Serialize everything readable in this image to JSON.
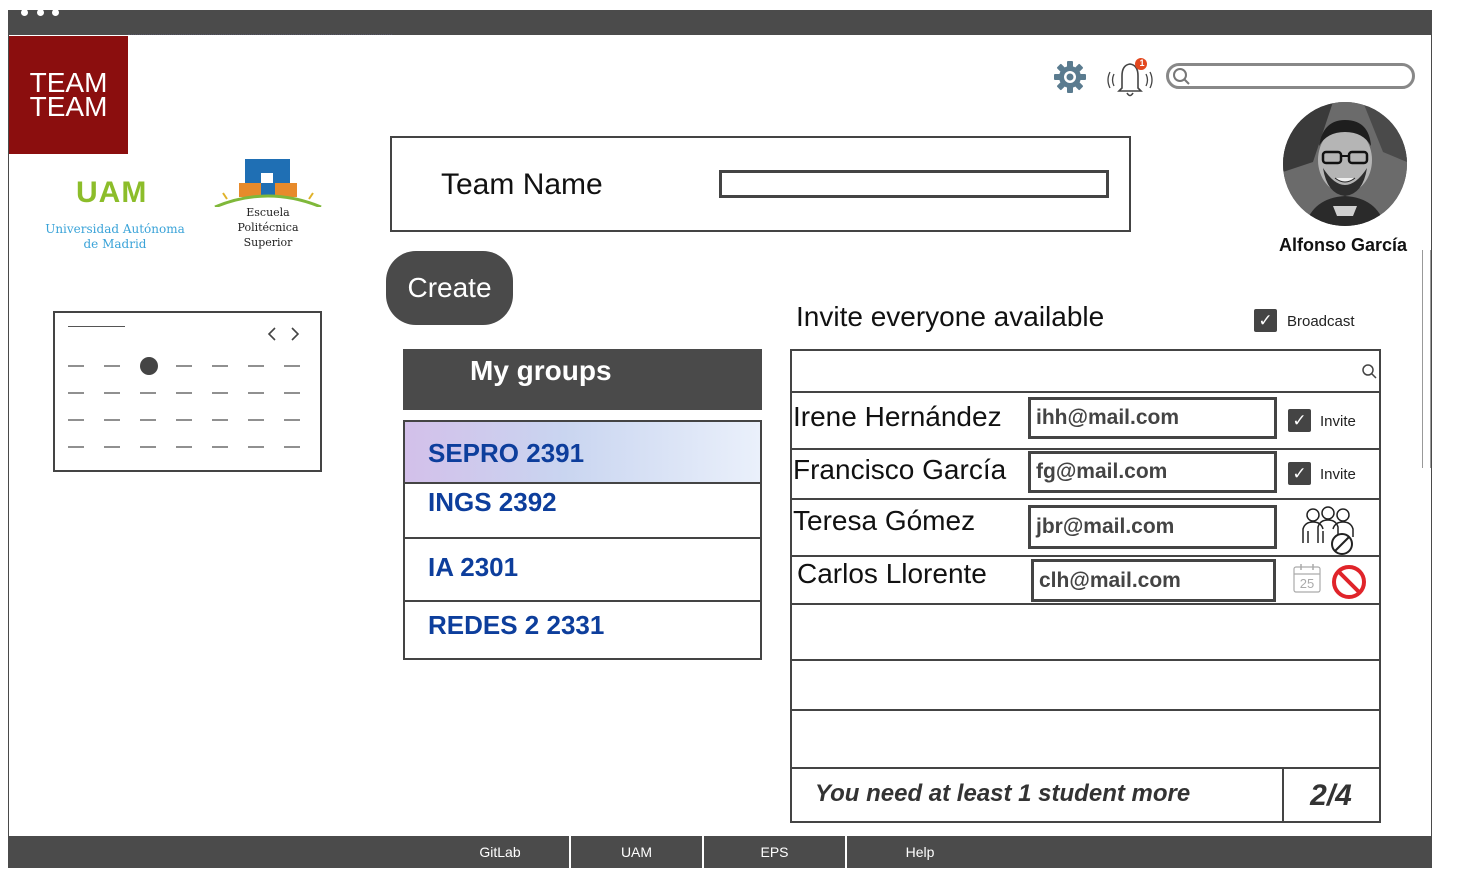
{
  "logo": {
    "line1": "TEAM",
    "line2": "TEAM"
  },
  "uam": {
    "mark": "UAM",
    "line1": "Universidad Autónoma",
    "line2": "de Madrid"
  },
  "eps": {
    "line1": "Escuela",
    "line2": "Politécnica",
    "line3": "Superior"
  },
  "header": {
    "notification_count": "1",
    "search_placeholder": "",
    "user_name": "Alfonso García"
  },
  "team_form": {
    "label": "Team Name",
    "value": "",
    "create_label": "Create"
  },
  "groups": {
    "title": "My groups",
    "items": [
      {
        "label": "SEPRO 2391",
        "selected": true
      },
      {
        "label": "INGS 2392",
        "selected": false
      },
      {
        "label": "IA 2301",
        "selected": false
      },
      {
        "label": "REDES 2 2331",
        "selected": false
      }
    ]
  },
  "invite": {
    "title": "Invite everyone available",
    "broadcast_label": "Broadcast",
    "broadcast_checked": true,
    "rows": [
      {
        "name": "Irene Hernández",
        "email": "ihh@mail.com",
        "status": "invite",
        "invite_label": "Invite"
      },
      {
        "name": "Francisco García",
        "email": "fg@mail.com",
        "status": "invite",
        "invite_label": "Invite"
      },
      {
        "name": "Teresa Gómez",
        "email": "jbr@mail.com",
        "status": "already-in-team"
      },
      {
        "name": "Carlos Llorente",
        "email": "clh@mail.com",
        "status": "unavailable",
        "calendar_day": "25"
      }
    ],
    "footer_message": "You need at least 1 student more",
    "footer_count": "2/4"
  },
  "footer_nav": [
    {
      "label": "GitLab"
    },
    {
      "label": "UAM"
    },
    {
      "label": "EPS"
    },
    {
      "label": "Help"
    }
  ],
  "colors": {
    "logo_bg": "#8b0e0e",
    "dark": "#4a4a4a",
    "group_text": "#0d3e9c",
    "uam_green": "#8cbd2a",
    "uam_blue": "#3aa3d8",
    "forbidden_red": "#e0242a"
  }
}
